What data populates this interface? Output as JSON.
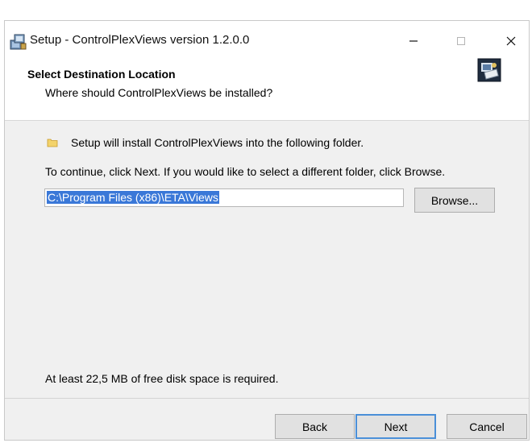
{
  "window": {
    "title": "Setup - ControlPlexViews version 1.2.0.0",
    "minimize_icon": "minimize-icon",
    "maximize_icon": "maximize-icon",
    "close_icon": "close-icon"
  },
  "header": {
    "title": "Select Destination Location",
    "subtitle": "Where should ControlPlexViews be installed?",
    "icon": "setup-wizard-icon"
  },
  "content": {
    "folder_icon": "folder-icon",
    "info": "Setup will install ControlPlexViews into the following folder.",
    "instructions": "To continue, click Next. If you would like to select a different folder, click Browse.",
    "path_value": "C:\\Program Files (x86)\\ETA\\Views",
    "browse_label": "Browse...",
    "disk_space": "At least 22,5 MB of free disk space is required."
  },
  "footer": {
    "back_label": "Back",
    "next_label": "Next",
    "cancel_label": "Cancel"
  },
  "colors": {
    "selection": "#3a78d8",
    "default_button_border": "#4a8fd8",
    "dialog_background": "#f0f0f0"
  }
}
